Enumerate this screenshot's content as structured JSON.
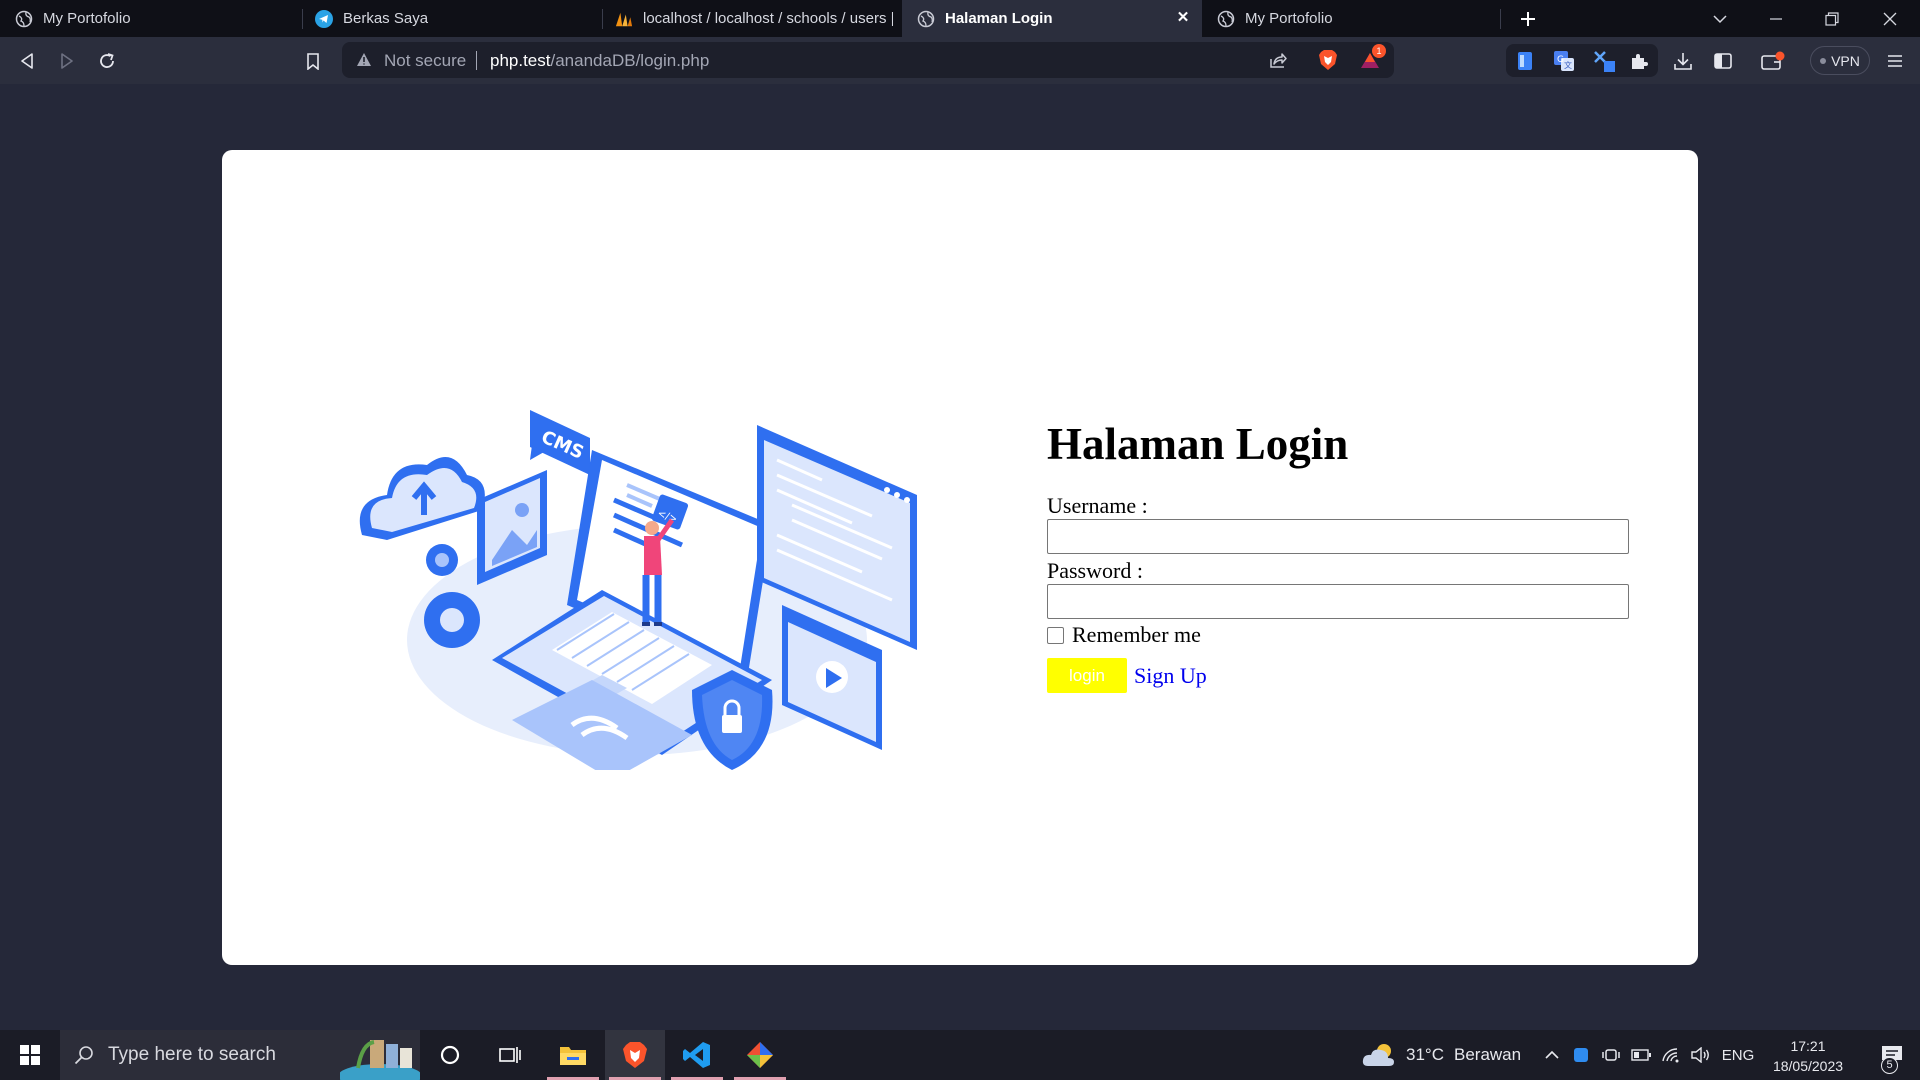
{
  "browser": {
    "tabs": [
      {
        "title": "My Portofolio",
        "icon": "globe-icon",
        "active": false
      },
      {
        "title": "Berkas Saya",
        "icon": "telegram-icon",
        "active": false
      },
      {
        "title": "localhost / localhost / schools / users |",
        "icon": "phpmyadmin-icon",
        "active": false
      },
      {
        "title": "Halaman Login",
        "icon": "globe-icon",
        "active": true
      },
      {
        "title": "My Portofolio",
        "icon": "globe-icon",
        "active": false
      }
    ],
    "address": {
      "security_label": "Not secure",
      "host": "php.test",
      "path": "/anandaDB/login.php"
    },
    "vpn_label": "VPN",
    "rewards_badge": "1",
    "accent": "#fb542b"
  },
  "page": {
    "heading": "Halaman Login",
    "username_label": "Username :",
    "username_value": "",
    "password_label": "Password :",
    "password_value": "",
    "remember_label": "Remember me",
    "remember_checked": false,
    "login_button": "login",
    "signup_link": "Sign Up",
    "illustration_text": {
      "cms": "CMS",
      "code": "</>"
    },
    "colors": {
      "login_bg": "#ffff00",
      "card_bg": "#ffffff",
      "page_bg": "#252839",
      "illustration_blue": "#2f6ff0"
    }
  },
  "taskbar": {
    "search_placeholder": "Type here to search",
    "apps": [
      "cortana-icon",
      "task-view-icon",
      "file-explorer-icon",
      "brave-icon",
      "vscode-icon",
      "git-icon"
    ],
    "weather": {
      "temp": "31°C",
      "condition": "Berawan"
    },
    "language": "ENG",
    "time": "17:21",
    "date": "18/05/2023",
    "notification_count": "5"
  }
}
